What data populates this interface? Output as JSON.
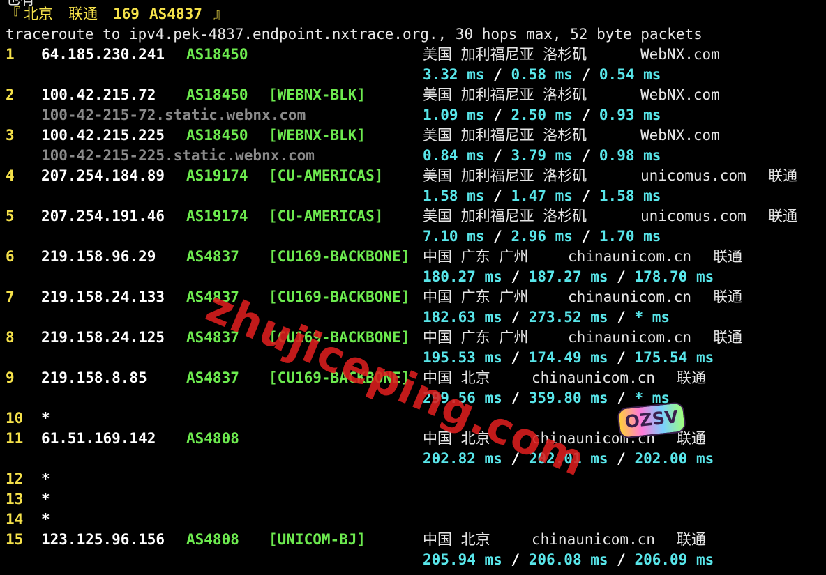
{
  "terminal": {
    "cutoff_line": "也有测实测效果 被测试结果已经说明了关于是否适用的   送往国内的话可以测试的  参数",
    "header": {
      "open": "『",
      "city": "北京",
      "isp": "联通",
      "code": "169",
      "asn": "AS4837",
      "close": "』"
    },
    "traceroute_line": "traceroute to ipv4.pek-4837.endpoint.nxtrace.org., 30 hops max, 52 byte packets",
    "hops": [
      {
        "num": "1",
        "ip": "64.185.230.241",
        "asn": "AS18450",
        "tag": "",
        "geo": "美国 加利福尼亚 洛杉矶",
        "org": "WebNX.com",
        "isp": "",
        "ptr": "",
        "rtt": [
          "3.32 ms",
          "0.58 ms",
          "0.54 ms"
        ]
      },
      {
        "num": "2",
        "ip": "100.42.215.72",
        "asn": "AS18450",
        "tag": "[WEBNX-BLK]",
        "geo": "美国 加利福尼亚 洛杉矶",
        "org": "WebNX.com",
        "isp": "",
        "ptr": "100-42-215-72.static.webnx.com",
        "rtt": [
          "1.09 ms",
          "2.50 ms",
          "0.93 ms"
        ]
      },
      {
        "num": "3",
        "ip": "100.42.215.225",
        "asn": "AS18450",
        "tag": "[WEBNX-BLK]",
        "geo": "美国 加利福尼亚 洛杉矶",
        "org": "WebNX.com",
        "isp": "",
        "ptr": "100-42-215-225.static.webnx.com",
        "rtt": [
          "0.84 ms",
          "3.79 ms",
          "0.98 ms"
        ]
      },
      {
        "num": "4",
        "ip": "207.254.184.89",
        "asn": "AS19174",
        "tag": "[CU-AMERICAS]",
        "geo": "美国 加利福尼亚 洛杉矶",
        "org": "unicomus.com",
        "isp": "联通",
        "ptr": "",
        "rtt": [
          "1.58 ms",
          "1.47 ms",
          "1.58 ms"
        ]
      },
      {
        "num": "5",
        "ip": "207.254.191.46",
        "asn": "AS19174",
        "tag": "[CU-AMERICAS]",
        "geo": "美国 加利福尼亚 洛杉矶",
        "org": "unicomus.com",
        "isp": "联通",
        "ptr": "",
        "rtt": [
          "7.10 ms",
          "2.96 ms",
          "1.70 ms"
        ]
      },
      {
        "num": "6",
        "ip": "219.158.96.29",
        "asn": "AS4837",
        "tag": "[CU169-BACKBONE]",
        "geo": "中国 广东 广州",
        "org": "chinaunicom.cn",
        "isp": "联通",
        "ptr": "",
        "rtt": [
          "180.27 ms",
          "187.27 ms",
          "178.70 ms"
        ]
      },
      {
        "num": "7",
        "ip": "219.158.24.133",
        "asn": "AS4837",
        "tag": "[CU169-BACKBONE]",
        "geo": "中国 广东 广州",
        "org": "chinaunicom.cn",
        "isp": "联通",
        "ptr": "",
        "rtt": [
          "182.63 ms",
          "273.52 ms",
          "* ms"
        ]
      },
      {
        "num": "8",
        "ip": "219.158.24.125",
        "asn": "AS4837",
        "tag": "[CU169-BACKBONE]",
        "geo": "中国 广东 广州",
        "org": "chinaunicom.cn",
        "isp": "联通",
        "ptr": "",
        "rtt": [
          "195.53 ms",
          "174.49 ms",
          "175.54 ms"
        ]
      },
      {
        "num": "9",
        "ip": "219.158.8.85",
        "asn": "AS4837",
        "tag": "[CU169-BACKBONE]",
        "geo": "中国 北京",
        "org": "chinaunicom.cn",
        "isp": "联通",
        "ptr": "",
        "rtt": [
          "299.56 ms",
          "359.80 ms",
          "* ms"
        ]
      },
      {
        "num": "10",
        "ip": "*",
        "asn": "",
        "tag": "",
        "geo": "",
        "org": "",
        "isp": "",
        "ptr": "",
        "rtt": []
      },
      {
        "num": "11",
        "ip": "61.51.169.142",
        "asn": "AS4808",
        "tag": "",
        "geo": "中国 北京",
        "org": "chinaunicom.cn",
        "isp": "联通",
        "ptr": "",
        "rtt": [
          "202.82 ms",
          "202.01 ms",
          "202.00 ms"
        ]
      },
      {
        "num": "12",
        "ip": "*",
        "asn": "",
        "tag": "",
        "geo": "",
        "org": "",
        "isp": "",
        "ptr": "",
        "rtt": []
      },
      {
        "num": "13",
        "ip": "*",
        "asn": "",
        "tag": "",
        "geo": "",
        "org": "",
        "isp": "",
        "ptr": "",
        "rtt": []
      },
      {
        "num": "14",
        "ip": "*",
        "asn": "",
        "tag": "",
        "geo": "",
        "org": "",
        "isp": "",
        "ptr": "",
        "rtt": []
      },
      {
        "num": "15",
        "ip": "123.125.96.156",
        "asn": "AS4808",
        "tag": "[UNICOM-BJ]",
        "geo": "中国 北京",
        "org": "chinaunicom.cn",
        "isp": "联通",
        "ptr": "",
        "rtt": [
          "205.94 ms",
          "206.08 ms",
          "206.09 ms"
        ]
      }
    ]
  },
  "watermark": {
    "text": "zhujiceping.com",
    "color": "#dc1e1e"
  },
  "logo": {
    "text": "OZSV"
  },
  "colors": {
    "background": "#000000",
    "hop_number": "#f5e14a",
    "ip": "#ffffff",
    "asn": "#6dea4f",
    "rtt": "#59e6ea",
    "ptr": "#8a8a8a",
    "geo": "#e6e6e6"
  }
}
